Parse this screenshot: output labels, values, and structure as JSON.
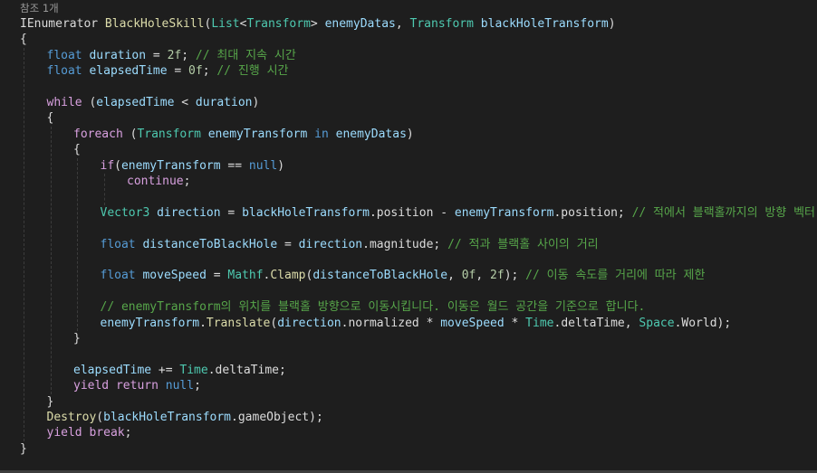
{
  "editor": {
    "reference_hint": "참조 1개",
    "lines": [
      {
        "indent": 0,
        "tokens": [
          [
            "plain",
            "IEnumerator "
          ],
          [
            "meth",
            "BlackHoleSkill"
          ],
          [
            "plain",
            "("
          ],
          [
            "type",
            "List"
          ],
          [
            "plain",
            "<"
          ],
          [
            "type",
            "Transform"
          ],
          [
            "plain",
            "> "
          ],
          [
            "var",
            "enemyDatas"
          ],
          [
            "plain",
            ", "
          ],
          [
            "type",
            "Transform"
          ],
          [
            "plain",
            " "
          ],
          [
            "var",
            "blackHoleTransform"
          ],
          [
            "plain",
            ")"
          ]
        ]
      },
      {
        "indent": 0,
        "tokens": [
          [
            "plain",
            "{"
          ]
        ]
      },
      {
        "indent": 1,
        "tokens": [
          [
            "kw",
            "float"
          ],
          [
            "plain",
            " "
          ],
          [
            "var",
            "duration"
          ],
          [
            "plain",
            " = "
          ],
          [
            "num",
            "2f"
          ],
          [
            "plain",
            "; "
          ],
          [
            "com",
            "// 최대 지속 시간"
          ]
        ]
      },
      {
        "indent": 1,
        "tokens": [
          [
            "kw",
            "float"
          ],
          [
            "plain",
            " "
          ],
          [
            "var",
            "elapsedTime"
          ],
          [
            "plain",
            " = "
          ],
          [
            "num",
            "0f"
          ],
          [
            "plain",
            "; "
          ],
          [
            "com",
            "// 진행 시간"
          ]
        ]
      },
      {
        "indent": 1,
        "tokens": []
      },
      {
        "indent": 1,
        "tokens": [
          [
            "ctl",
            "while"
          ],
          [
            "plain",
            " ("
          ],
          [
            "var",
            "elapsedTime"
          ],
          [
            "plain",
            " < "
          ],
          [
            "var",
            "duration"
          ],
          [
            "plain",
            ")"
          ]
        ]
      },
      {
        "indent": 1,
        "tokens": [
          [
            "plain",
            "{"
          ]
        ]
      },
      {
        "indent": 2,
        "tokens": [
          [
            "ctl",
            "foreach"
          ],
          [
            "plain",
            " ("
          ],
          [
            "type",
            "Transform"
          ],
          [
            "plain",
            " "
          ],
          [
            "var",
            "enemyTransform"
          ],
          [
            "plain",
            " "
          ],
          [
            "kw",
            "in"
          ],
          [
            "plain",
            " "
          ],
          [
            "var",
            "enemyDatas"
          ],
          [
            "plain",
            ")"
          ]
        ]
      },
      {
        "indent": 2,
        "tokens": [
          [
            "plain",
            "{"
          ]
        ]
      },
      {
        "indent": 3,
        "tokens": [
          [
            "ctl",
            "if"
          ],
          [
            "plain",
            "("
          ],
          [
            "var",
            "enemyTransform"
          ],
          [
            "plain",
            " == "
          ],
          [
            "kw",
            "null"
          ],
          [
            "plain",
            ")"
          ]
        ]
      },
      {
        "indent": 4,
        "tokens": [
          [
            "ctl",
            "continue"
          ],
          [
            "plain",
            ";"
          ]
        ]
      },
      {
        "indent": 3,
        "tokens": []
      },
      {
        "indent": 3,
        "tokens": [
          [
            "type",
            "Vector3"
          ],
          [
            "plain",
            " "
          ],
          [
            "var",
            "direction"
          ],
          [
            "plain",
            " = "
          ],
          [
            "var",
            "blackHoleTransform"
          ],
          [
            "plain",
            "."
          ],
          [
            "prop",
            "position"
          ],
          [
            "plain",
            " - "
          ],
          [
            "var",
            "enemyTransform"
          ],
          [
            "plain",
            "."
          ],
          [
            "prop",
            "position"
          ],
          [
            "plain",
            "; "
          ],
          [
            "com",
            "// 적에서 블랙홀까지의 방향 벡터"
          ]
        ]
      },
      {
        "indent": 3,
        "tokens": []
      },
      {
        "indent": 3,
        "tokens": [
          [
            "kw",
            "float"
          ],
          [
            "plain",
            " "
          ],
          [
            "var",
            "distanceToBlackHole"
          ],
          [
            "plain",
            " = "
          ],
          [
            "var",
            "direction"
          ],
          [
            "plain",
            "."
          ],
          [
            "prop",
            "magnitude"
          ],
          [
            "plain",
            "; "
          ],
          [
            "com",
            "// 적과 블랙홀 사이의 거리"
          ]
        ]
      },
      {
        "indent": 3,
        "tokens": []
      },
      {
        "indent": 3,
        "tokens": [
          [
            "kw",
            "float"
          ],
          [
            "plain",
            " "
          ],
          [
            "var",
            "moveSpeed"
          ],
          [
            "plain",
            " = "
          ],
          [
            "type",
            "Mathf"
          ],
          [
            "plain",
            "."
          ],
          [
            "meth",
            "Clamp"
          ],
          [
            "plain",
            "("
          ],
          [
            "var",
            "distanceToBlackHole"
          ],
          [
            "plain",
            ", "
          ],
          [
            "num",
            "0f"
          ],
          [
            "plain",
            ", "
          ],
          [
            "num",
            "2f"
          ],
          [
            "plain",
            "); "
          ],
          [
            "com",
            "// 이동 속도를 거리에 따라 제한"
          ]
        ]
      },
      {
        "indent": 3,
        "tokens": []
      },
      {
        "indent": 3,
        "tokens": [
          [
            "com",
            "// enemyTransform의 위치를 블랙홀 방향으로 이동시킵니다. 이동은 월드 공간을 기준으로 합니다."
          ]
        ]
      },
      {
        "indent": 3,
        "tokens": [
          [
            "var",
            "enemyTransform"
          ],
          [
            "plain",
            "."
          ],
          [
            "meth",
            "Translate"
          ],
          [
            "plain",
            "("
          ],
          [
            "var",
            "direction"
          ],
          [
            "plain",
            "."
          ],
          [
            "prop",
            "normalized"
          ],
          [
            "plain",
            " * "
          ],
          [
            "var",
            "moveSpeed"
          ],
          [
            "plain",
            " * "
          ],
          [
            "type",
            "Time"
          ],
          [
            "plain",
            "."
          ],
          [
            "prop",
            "deltaTime"
          ],
          [
            "plain",
            ", "
          ],
          [
            "type",
            "Space"
          ],
          [
            "plain",
            "."
          ],
          [
            "prop",
            "World"
          ],
          [
            "plain",
            ");"
          ]
        ]
      },
      {
        "indent": 2,
        "tokens": [
          [
            "plain",
            "}"
          ]
        ]
      },
      {
        "indent": 2,
        "tokens": []
      },
      {
        "indent": 2,
        "tokens": [
          [
            "var",
            "elapsedTime"
          ],
          [
            "plain",
            " += "
          ],
          [
            "type",
            "Time"
          ],
          [
            "plain",
            "."
          ],
          [
            "prop",
            "deltaTime"
          ],
          [
            "plain",
            ";"
          ]
        ]
      },
      {
        "indent": 2,
        "tokens": [
          [
            "ctl",
            "yield"
          ],
          [
            "plain",
            " "
          ],
          [
            "ctl",
            "return"
          ],
          [
            "plain",
            " "
          ],
          [
            "kw",
            "null"
          ],
          [
            "plain",
            ";"
          ]
        ]
      },
      {
        "indent": 1,
        "tokens": [
          [
            "plain",
            "}"
          ]
        ]
      },
      {
        "indent": 1,
        "tokens": [
          [
            "meth",
            "Destroy"
          ],
          [
            "plain",
            "("
          ],
          [
            "var",
            "blackHoleTransform"
          ],
          [
            "plain",
            "."
          ],
          [
            "prop",
            "gameObject"
          ],
          [
            "plain",
            ");"
          ]
        ]
      },
      {
        "indent": 1,
        "tokens": [
          [
            "ctl",
            "yield"
          ],
          [
            "plain",
            " "
          ],
          [
            "ctl",
            "break"
          ],
          [
            "plain",
            ";"
          ]
        ]
      },
      {
        "indent": 0,
        "tokens": [
          [
            "plain",
            "}"
          ]
        ]
      }
    ]
  }
}
